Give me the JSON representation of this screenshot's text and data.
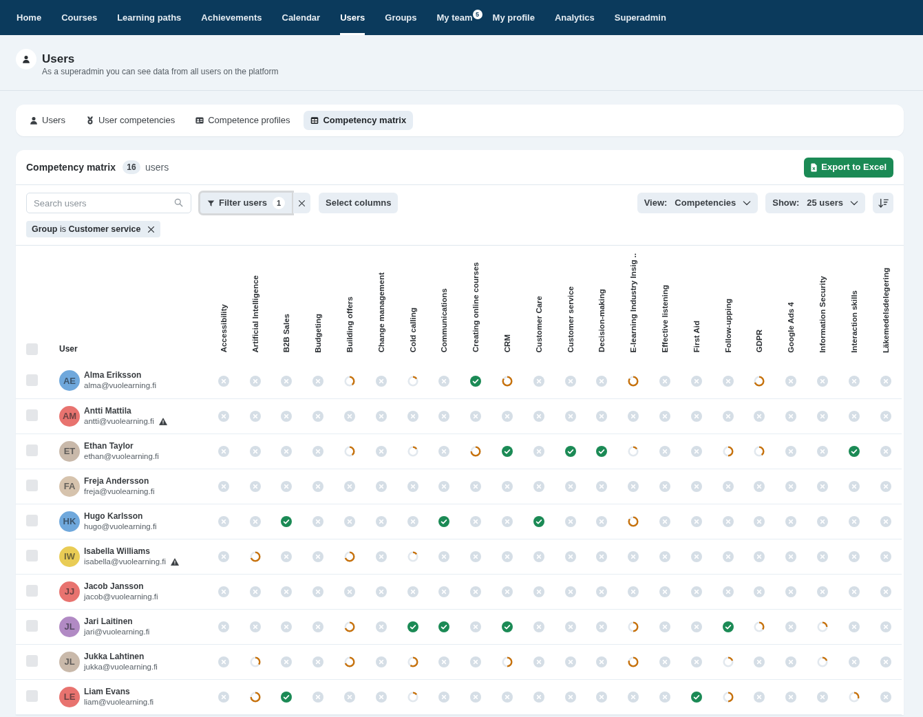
{
  "nav": {
    "items": [
      {
        "label": "Home",
        "selected": false
      },
      {
        "label": "Courses",
        "selected": false
      },
      {
        "label": "Learning paths",
        "selected": false
      },
      {
        "label": "Achievements",
        "selected": false
      },
      {
        "label": "Calendar",
        "selected": false
      },
      {
        "label": "Users",
        "selected": true
      },
      {
        "label": "Groups",
        "selected": false
      },
      {
        "label": "My team",
        "selected": false,
        "badge": "5"
      },
      {
        "label": "My profile",
        "selected": false
      },
      {
        "label": "Analytics",
        "selected": false
      },
      {
        "label": "Superadmin",
        "selected": false
      }
    ]
  },
  "page_header": {
    "title": "Users",
    "subtitle": "As a superadmin you can see data from all users on the platform"
  },
  "tabs": [
    {
      "label": "Users",
      "selected": false
    },
    {
      "label": "User competencies",
      "selected": false
    },
    {
      "label": "Competence profiles",
      "selected": false
    },
    {
      "label": "Competency matrix",
      "selected": true
    }
  ],
  "matrix_card": {
    "title": "Competency matrix",
    "count": "16",
    "count_label": "users",
    "export_button": "Export to Excel"
  },
  "toolbar": {
    "search": {
      "placeholder": "Search users"
    },
    "filter_button": {
      "label": "Filter users",
      "count": "1",
      "focused": true
    },
    "select_columns": "Select columns",
    "view": {
      "label": "View:",
      "value": "Competencies"
    },
    "show": {
      "label": "Show:",
      "value": "25 users"
    }
  },
  "active_filters": [
    {
      "text": "**Group** is **Customer service**"
    }
  ],
  "table": {
    "select_all": {
      "checked": false
    },
    "user_column": "User",
    "columns": [
      "Accessibility",
      "Artificial Intelligence",
      "B2B Sales",
      "Budgeting",
      "Building offers",
      "Change management",
      "Cold calling",
      "Communications",
      "Creating online courses",
      "CRM",
      "Customer Care",
      "Customer service",
      "Decision-making",
      "E-learning Industry Insig ..",
      "Effective listening",
      "First Aid",
      "Follow-upping",
      "GDPR",
      "Google Ads 4",
      "Information Security",
      "Interaction skills",
      "Läkemedelsdelegering"
    ],
    "rows": [
      {
        "name": "Alma Eriksson",
        "email": "alma@vuolearning.fi",
        "initials": "AE",
        "color": "#6fa8dc",
        "warning": false,
        "checked": false,
        "cells": [
          {
            "kind": "none"
          },
          {
            "kind": "none"
          },
          {
            "kind": "none"
          },
          {
            "kind": "none"
          },
          {
            "kind": "partial",
            "level": 0.4
          },
          {
            "kind": "none"
          },
          {
            "kind": "partial",
            "level": 0.15
          },
          {
            "kind": "none"
          },
          {
            "kind": "done"
          },
          {
            "kind": "partial",
            "level": 0.85
          },
          {
            "kind": "none"
          },
          {
            "kind": "none"
          },
          {
            "kind": "none"
          },
          {
            "kind": "partial",
            "level": 0.85
          },
          {
            "kind": "none"
          },
          {
            "kind": "none"
          },
          {
            "kind": "none"
          },
          {
            "kind": "partial",
            "level": 0.7
          },
          {
            "kind": "none"
          },
          {
            "kind": "none"
          },
          {
            "kind": "none"
          },
          {
            "kind": "none"
          }
        ]
      },
      {
        "name": "Antti Mattila",
        "email": "antti@vuolearning.fi",
        "initials": "AM",
        "color": "#e8736f",
        "warning": true,
        "checked": false,
        "cells": [
          {
            "kind": "none"
          },
          {
            "kind": "none"
          },
          {
            "kind": "none"
          },
          {
            "kind": "none"
          },
          {
            "kind": "none"
          },
          {
            "kind": "none"
          },
          {
            "kind": "none"
          },
          {
            "kind": "none"
          },
          {
            "kind": "none"
          },
          {
            "kind": "none"
          },
          {
            "kind": "none"
          },
          {
            "kind": "none"
          },
          {
            "kind": "none"
          },
          {
            "kind": "none"
          },
          {
            "kind": "none"
          },
          {
            "kind": "none"
          },
          {
            "kind": "none"
          },
          {
            "kind": "none"
          },
          {
            "kind": "none"
          },
          {
            "kind": "none"
          },
          {
            "kind": "none"
          },
          {
            "kind": "none"
          }
        ]
      },
      {
        "name": "Ethan Taylor",
        "email": "ethan@vuolearning.fi",
        "initials": "ET",
        "color": "#c9b9aa",
        "warning": false,
        "checked": false,
        "cells": [
          {
            "kind": "none"
          },
          {
            "kind": "none"
          },
          {
            "kind": "none"
          },
          {
            "kind": "none"
          },
          {
            "kind": "partial",
            "level": 0.4
          },
          {
            "kind": "none"
          },
          {
            "kind": "partial",
            "level": 0.15
          },
          {
            "kind": "none"
          },
          {
            "kind": "partial",
            "level": 0.75
          },
          {
            "kind": "done"
          },
          {
            "kind": "none"
          },
          {
            "kind": "done"
          },
          {
            "kind": "done"
          },
          {
            "kind": "partial",
            "level": 0.15
          },
          {
            "kind": "none"
          },
          {
            "kind": "none"
          },
          {
            "kind": "partial",
            "level": 0.5
          },
          {
            "kind": "partial",
            "level": 0.4
          },
          {
            "kind": "none"
          },
          {
            "kind": "none"
          },
          {
            "kind": "done"
          },
          {
            "kind": "none"
          }
        ]
      },
      {
        "name": "Freja Andersson",
        "email": "freja@vuolearning.fi",
        "initials": "FA",
        "color": "#d6c3ad",
        "warning": false,
        "checked": false,
        "cells": [
          {
            "kind": "none"
          },
          {
            "kind": "none"
          },
          {
            "kind": "none"
          },
          {
            "kind": "none"
          },
          {
            "kind": "none"
          },
          {
            "kind": "none"
          },
          {
            "kind": "none"
          },
          {
            "kind": "none"
          },
          {
            "kind": "none"
          },
          {
            "kind": "none"
          },
          {
            "kind": "none"
          },
          {
            "kind": "none"
          },
          {
            "kind": "none"
          },
          {
            "kind": "none"
          },
          {
            "kind": "none"
          },
          {
            "kind": "none"
          },
          {
            "kind": "none"
          },
          {
            "kind": "none"
          },
          {
            "kind": "none"
          },
          {
            "kind": "none"
          },
          {
            "kind": "none"
          },
          {
            "kind": "none"
          }
        ]
      },
      {
        "name": "Hugo Karlsson",
        "email": "hugo@vuolearning.fi",
        "initials": "HK",
        "color": "#6fa8dc",
        "warning": false,
        "checked": false,
        "cells": [
          {
            "kind": "none"
          },
          {
            "kind": "none"
          },
          {
            "kind": "done"
          },
          {
            "kind": "none"
          },
          {
            "kind": "none"
          },
          {
            "kind": "none"
          },
          {
            "kind": "none"
          },
          {
            "kind": "done"
          },
          {
            "kind": "none"
          },
          {
            "kind": "none"
          },
          {
            "kind": "done"
          },
          {
            "kind": "none"
          },
          {
            "kind": "none"
          },
          {
            "kind": "partial",
            "level": 0.85
          },
          {
            "kind": "none"
          },
          {
            "kind": "none"
          },
          {
            "kind": "none"
          },
          {
            "kind": "none"
          },
          {
            "kind": "none"
          },
          {
            "kind": "none"
          },
          {
            "kind": "none"
          },
          {
            "kind": "none"
          }
        ]
      },
      {
        "name": "Isabella Williams",
        "email": "isabella@vuolearning.fi",
        "initials": "IW",
        "color": "#e9cc55",
        "warning": true,
        "checked": false,
        "cells": [
          {
            "kind": "none"
          },
          {
            "kind": "partial",
            "level": 0.7
          },
          {
            "kind": "none"
          },
          {
            "kind": "none"
          },
          {
            "kind": "partial",
            "level": 0.7
          },
          {
            "kind": "none"
          },
          {
            "kind": "partial",
            "level": 0.15
          },
          {
            "kind": "none"
          },
          {
            "kind": "none"
          },
          {
            "kind": "none"
          },
          {
            "kind": "none"
          },
          {
            "kind": "none"
          },
          {
            "kind": "none"
          },
          {
            "kind": "none"
          },
          {
            "kind": "none"
          },
          {
            "kind": "none"
          },
          {
            "kind": "none"
          },
          {
            "kind": "none"
          },
          {
            "kind": "none"
          },
          {
            "kind": "none"
          },
          {
            "kind": "none"
          },
          {
            "kind": "none"
          }
        ]
      },
      {
        "name": "Jacob Jansson",
        "email": "jacob@vuolearning.fi",
        "initials": "JJ",
        "color": "#e8736f",
        "warning": false,
        "checked": false,
        "cells": [
          {
            "kind": "none"
          },
          {
            "kind": "none"
          },
          {
            "kind": "none"
          },
          {
            "kind": "none"
          },
          {
            "kind": "none"
          },
          {
            "kind": "none"
          },
          {
            "kind": "none"
          },
          {
            "kind": "none"
          },
          {
            "kind": "none"
          },
          {
            "kind": "none"
          },
          {
            "kind": "none"
          },
          {
            "kind": "none"
          },
          {
            "kind": "none"
          },
          {
            "kind": "none"
          },
          {
            "kind": "none"
          },
          {
            "kind": "none"
          },
          {
            "kind": "none"
          },
          {
            "kind": "none"
          },
          {
            "kind": "none"
          },
          {
            "kind": "none"
          },
          {
            "kind": "none"
          },
          {
            "kind": "none"
          }
        ]
      },
      {
        "name": "Jari Laitinen",
        "email": "jari@vuolearning.fi",
        "initials": "JL",
        "color": "#b18ac4",
        "warning": false,
        "checked": false,
        "cells": [
          {
            "kind": "none"
          },
          {
            "kind": "none"
          },
          {
            "kind": "none"
          },
          {
            "kind": "none"
          },
          {
            "kind": "partial",
            "level": 0.7
          },
          {
            "kind": "none"
          },
          {
            "kind": "done"
          },
          {
            "kind": "done"
          },
          {
            "kind": "none"
          },
          {
            "kind": "done"
          },
          {
            "kind": "none"
          },
          {
            "kind": "none"
          },
          {
            "kind": "none"
          },
          {
            "kind": "partial",
            "level": 0.5
          },
          {
            "kind": "none"
          },
          {
            "kind": "none"
          },
          {
            "kind": "done"
          },
          {
            "kind": "partial",
            "level": 0.35
          },
          {
            "kind": "none"
          },
          {
            "kind": "partial",
            "level": 0.25
          },
          {
            "kind": "none"
          },
          {
            "kind": "none"
          }
        ]
      },
      {
        "name": "Jukka Lahtinen",
        "email": "jukka@vuolearning.fi",
        "initials": "JL",
        "color": "#c9b9aa",
        "warning": false,
        "checked": false,
        "cells": [
          {
            "kind": "none"
          },
          {
            "kind": "partial",
            "level": 0.35
          },
          {
            "kind": "none"
          },
          {
            "kind": "none"
          },
          {
            "kind": "partial",
            "level": 0.7
          },
          {
            "kind": "none"
          },
          {
            "kind": "partial",
            "level": 0.6
          },
          {
            "kind": "none"
          },
          {
            "kind": "none"
          },
          {
            "kind": "partial",
            "level": 0.5
          },
          {
            "kind": "none"
          },
          {
            "kind": "none"
          },
          {
            "kind": "none"
          },
          {
            "kind": "partial",
            "level": 0.8
          },
          {
            "kind": "none"
          },
          {
            "kind": "none"
          },
          {
            "kind": "partial",
            "level": 0.2
          },
          {
            "kind": "none"
          },
          {
            "kind": "none"
          },
          {
            "kind": "partial",
            "level": 0.2
          },
          {
            "kind": "none"
          },
          {
            "kind": "none"
          }
        ]
      },
      {
        "name": "Liam Evans",
        "email": "liam@vuolearning.fi",
        "initials": "LE",
        "color": "#e8736f",
        "warning": false,
        "checked": false,
        "cells": [
          {
            "kind": "none"
          },
          {
            "kind": "partial",
            "level": 0.75
          },
          {
            "kind": "done"
          },
          {
            "kind": "none"
          },
          {
            "kind": "none"
          },
          {
            "kind": "none"
          },
          {
            "kind": "partial",
            "level": 0.15
          },
          {
            "kind": "none"
          },
          {
            "kind": "none"
          },
          {
            "kind": "none"
          },
          {
            "kind": "none"
          },
          {
            "kind": "none"
          },
          {
            "kind": "none"
          },
          {
            "kind": "none"
          },
          {
            "kind": "none"
          },
          {
            "kind": "done"
          },
          {
            "kind": "partial",
            "level": 0.5
          },
          {
            "kind": "none"
          },
          {
            "kind": "none"
          },
          {
            "kind": "none"
          },
          {
            "kind": "partial",
            "level": 0.3
          },
          {
            "kind": "none"
          }
        ]
      }
    ]
  }
}
